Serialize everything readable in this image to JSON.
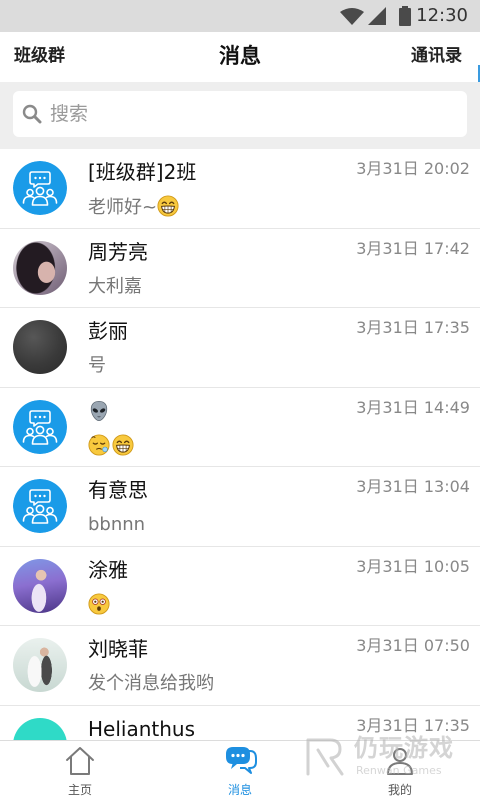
{
  "status_bar": {
    "time": "12:30",
    "icons": [
      "wifi-icon",
      "signal-icon",
      "battery-icon"
    ]
  },
  "header": {
    "left": "班级群",
    "title": "消息",
    "right": "通讯录"
  },
  "search": {
    "placeholder": "搜索",
    "icon": "search-icon"
  },
  "colors": {
    "accent": "#1e8fe0",
    "group_avatar": "#1a9be8"
  },
  "conversations": [
    {
      "avatar": "group-chat-icon",
      "name": "[班级群]2班",
      "name_emoji": [],
      "preview": "老师好~",
      "preview_emoji": [
        "grinning-face"
      ],
      "time": "3月31日 20:02"
    },
    {
      "avatar": "user-photo",
      "name": "周芳亮",
      "name_emoji": [],
      "preview": "大利嘉",
      "preview_emoji": [],
      "time": "3月31日 17:42"
    },
    {
      "avatar": "user-photo",
      "name": "彭丽",
      "name_emoji": [],
      "preview": "号",
      "preview_emoji": [],
      "time": "3月31日 17:35"
    },
    {
      "avatar": "group-chat-icon",
      "name": "",
      "name_emoji": [
        "alien-face"
      ],
      "preview": "",
      "preview_emoji": [
        "sleepy-face",
        "grinning-face"
      ],
      "time": "3月31日 14:49"
    },
    {
      "avatar": "group-chat-icon",
      "name": "有意思",
      "name_emoji": [],
      "preview": "bbnnn",
      "preview_emoji": [],
      "time": "3月31日 13:04"
    },
    {
      "avatar": "user-photo",
      "name": "涂雅",
      "name_emoji": [],
      "preview": "",
      "preview_emoji": [
        "astonished-face"
      ],
      "time": "3月31日 10:05"
    },
    {
      "avatar": "user-photo",
      "name": "刘晓菲",
      "name_emoji": [],
      "preview": "发个消息给我哟",
      "preview_emoji": [],
      "time": "3月31日 07:50"
    },
    {
      "avatar": "user-photo",
      "name": "Helianthus",
      "name_emoji": [],
      "preview": "",
      "preview_emoji": [],
      "time": "3月31日 17:35"
    }
  ],
  "bottom_nav": [
    {
      "label": "主页",
      "icon": "home-icon",
      "active": false
    },
    {
      "label": "消息",
      "icon": "chat-icon",
      "active": true
    },
    {
      "label": "我的",
      "icon": "person-icon",
      "active": false
    }
  ],
  "watermark": {
    "brand": "仍玩游戏",
    "tagline": "Renwan Games"
  }
}
